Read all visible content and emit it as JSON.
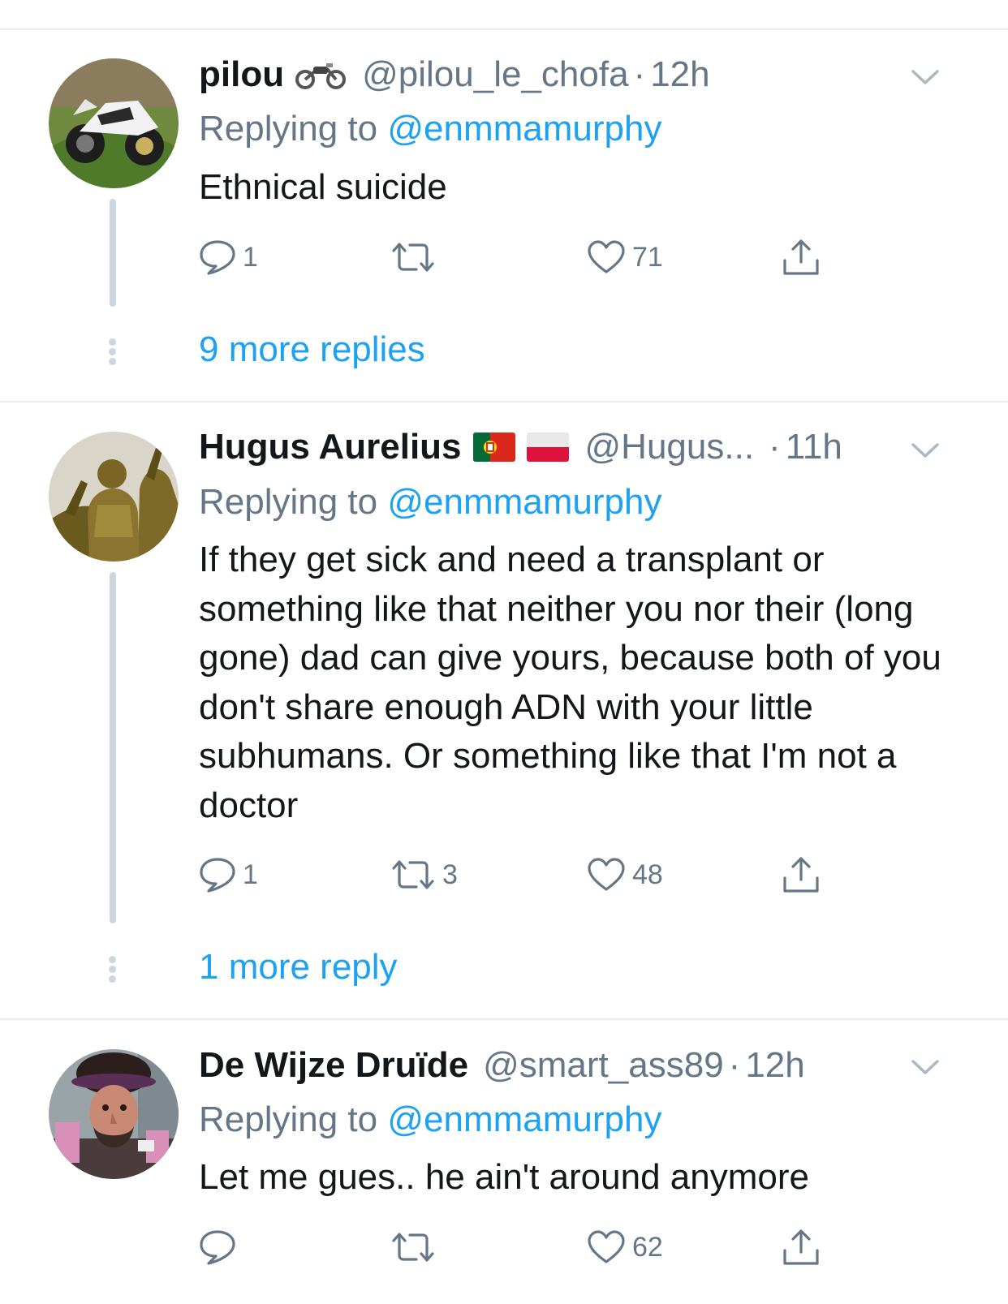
{
  "reply_prefix": "Replying to",
  "tweets": [
    {
      "name": "pilou",
      "handle": "@pilou_le_chofa",
      "time": "12h",
      "reply_to": "@enmmamurphy",
      "text": "Ethnical suicide",
      "replies": "1",
      "retweets": "",
      "likes": "71",
      "more_replies": "9 more replies"
    },
    {
      "name": "Hugus Aurelius",
      "handle": "@Hugus...",
      "time": "11h",
      "reply_to": "@enmmamurphy",
      "text": "If they get sick and need a transplant or something like that neither you nor their (long gone) dad can give yours, because both of you don't share enough ADN with your little subhumans. Or something like that I'm not a doctor",
      "replies": "1",
      "retweets": "3",
      "likes": "48",
      "more_replies": "1 more reply"
    },
    {
      "name": "De Wijze Druïde",
      "handle": "@smart_ass89",
      "time": "12h",
      "reply_to": "@enmmamurphy",
      "text": "Let me gues.. he ain't around anymore",
      "replies": "",
      "retweets": "",
      "likes": "62",
      "more_replies": ""
    }
  ],
  "icons": {
    "reply": "reply-icon",
    "retweet": "retweet-icon",
    "like": "heart-icon",
    "share": "share-icon",
    "menu": "chevron-down-icon"
  },
  "colors": {
    "link": "#1da1f2",
    "secondary": "#657786",
    "text": "#14171a",
    "divider": "#e6ecf0",
    "thread_line": "#ccd6dd"
  }
}
